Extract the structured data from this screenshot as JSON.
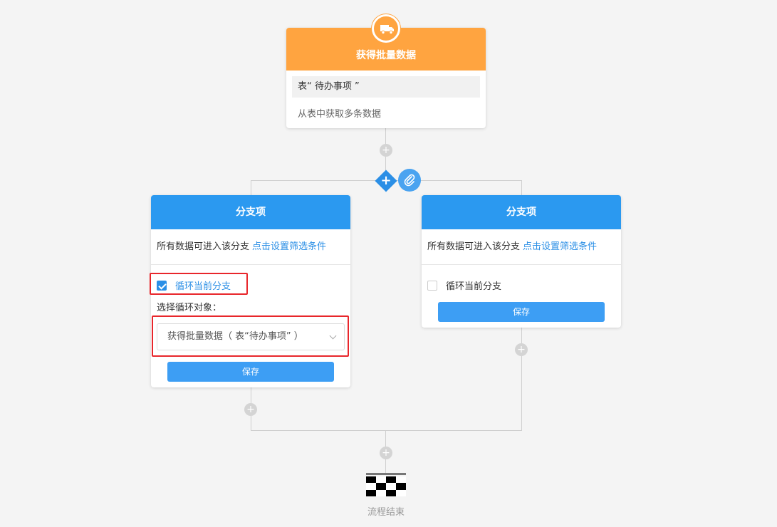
{
  "top_node": {
    "title": "获得批量数据",
    "table_label": "表“ 待办事项 ”",
    "description": "从表中获取多条数据",
    "icon": "truck-icon",
    "color": "#ffa440"
  },
  "branches": [
    {
      "title": "分支项",
      "condition_text": "所有数据可进入该分支",
      "condition_link": "点击设置筛选条件",
      "loop_checked": true,
      "loop_label": "循环当前分支",
      "loop_target_title": "选择循环对象：",
      "loop_target_value": "获得批量数据（ 表“待办事项” ）",
      "save_label": "保存"
    },
    {
      "title": "分支项",
      "condition_text": "所有数据可进入该分支",
      "condition_link": "点击设置筛选条件",
      "loop_checked": false,
      "loop_label": "循环当前分支",
      "save_label": "保存"
    }
  ],
  "controls": {
    "add_branch_icon": "plus-icon",
    "attach_icon": "paperclip-icon",
    "add_node_symbol": "+"
  },
  "end": {
    "label": "流程结束",
    "icon": "checkered-flag-icon"
  },
  "colors": {
    "accent": "#2b99f0",
    "orange": "#ffa440",
    "highlight": "#e8262b"
  }
}
